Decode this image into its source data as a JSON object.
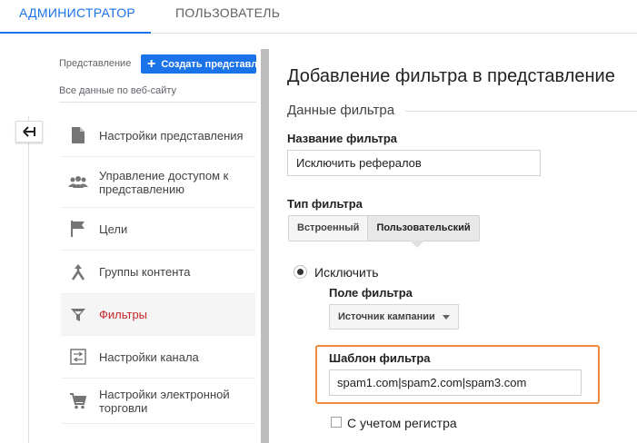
{
  "tabs": {
    "admin": "Администратор",
    "user": "Пользователь"
  },
  "left": {
    "view_label": "Представление",
    "create_button": "Создать представл",
    "view_name": "Все данные по веб-сайту",
    "nav": [
      {
        "label": "Настройки представления",
        "icon": "document-icon"
      },
      {
        "label": "Управление доступом к представлению",
        "icon": "people-icon"
      },
      {
        "label": "Цели",
        "icon": "flag-icon"
      },
      {
        "label": "Группы контента",
        "icon": "merge-arrows-icon"
      },
      {
        "label": "Фильтры",
        "icon": "filter-icon",
        "active": true
      },
      {
        "label": "Настройки канала",
        "icon": "channel-settings-icon"
      },
      {
        "label": "Настройки электронной торговли",
        "icon": "cart-icon"
      }
    ]
  },
  "main": {
    "title": "Добавление фильтра в представление",
    "section": "Данные фильтра",
    "filter_name_label": "Название фильтра",
    "filter_name_value": "Исключить рефералов",
    "filter_type_label": "Тип фильтра",
    "type_builtin": "Встроенный",
    "type_custom": "Пользовательский",
    "exclude_label": "Исключить",
    "filter_field_label": "Поле фильтра",
    "filter_field_value": "Источник кампании",
    "pattern_label": "Шаблон фильтра",
    "pattern_value": "spam1.com|spam2.com|spam3.com",
    "case_label": "С учетом регистра"
  },
  "colors": {
    "accent": "#1a73e8",
    "active_nav": "#c62828",
    "highlight": "#f08a3c"
  }
}
